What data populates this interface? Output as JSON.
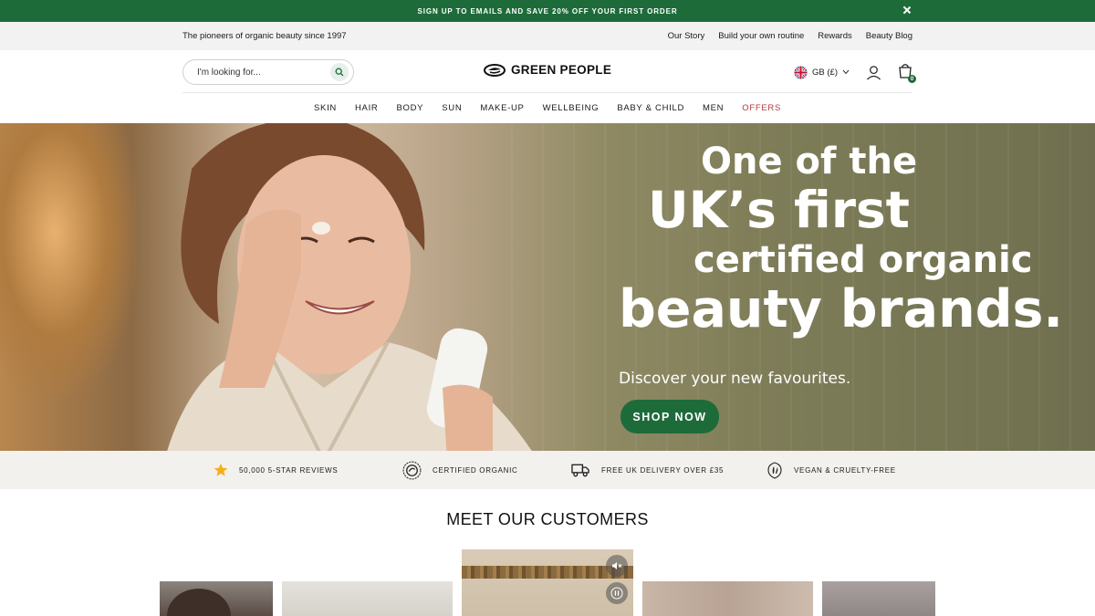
{
  "announcement": {
    "text": "SIGN UP TO EMAILS AND SAVE 20% OFF YOUR FIRST ORDER"
  },
  "utility": {
    "tagline": "The pioneers of organic beauty since 1997",
    "links": [
      "Our Story",
      "Build your own routine",
      "Rewards",
      "Beauty Blog"
    ]
  },
  "header": {
    "search_placeholder": "I'm looking for...",
    "brand": "GREEN PEOPLE",
    "locale": "GB (£)",
    "cart_count": "0"
  },
  "nav": [
    "SKIN",
    "HAIR",
    "BODY",
    "SUN",
    "MAKE-UP",
    "WELLBEING",
    "BABY & CHILD",
    "MEN",
    "OFFERS"
  ],
  "hero": {
    "line1": "One of the",
    "line2": "UK’s first",
    "line3": "certified organic",
    "line4": "beauty brands.",
    "subtitle": "Discover your new favourites.",
    "cta": "SHOP NOW"
  },
  "usp": [
    "50,000 5-STAR REVIEWS",
    "CERTIFIED ORGANIC",
    "FREE UK DELIVERY OVER £35",
    "VEGAN & CRUELTY-FREE"
  ],
  "customers": {
    "title": "MEET OUR CUSTOMERS"
  },
  "colors": {
    "brand_green": "#1e6b3a",
    "offers_red": "#b23a3a",
    "star": "#f2b01e"
  }
}
